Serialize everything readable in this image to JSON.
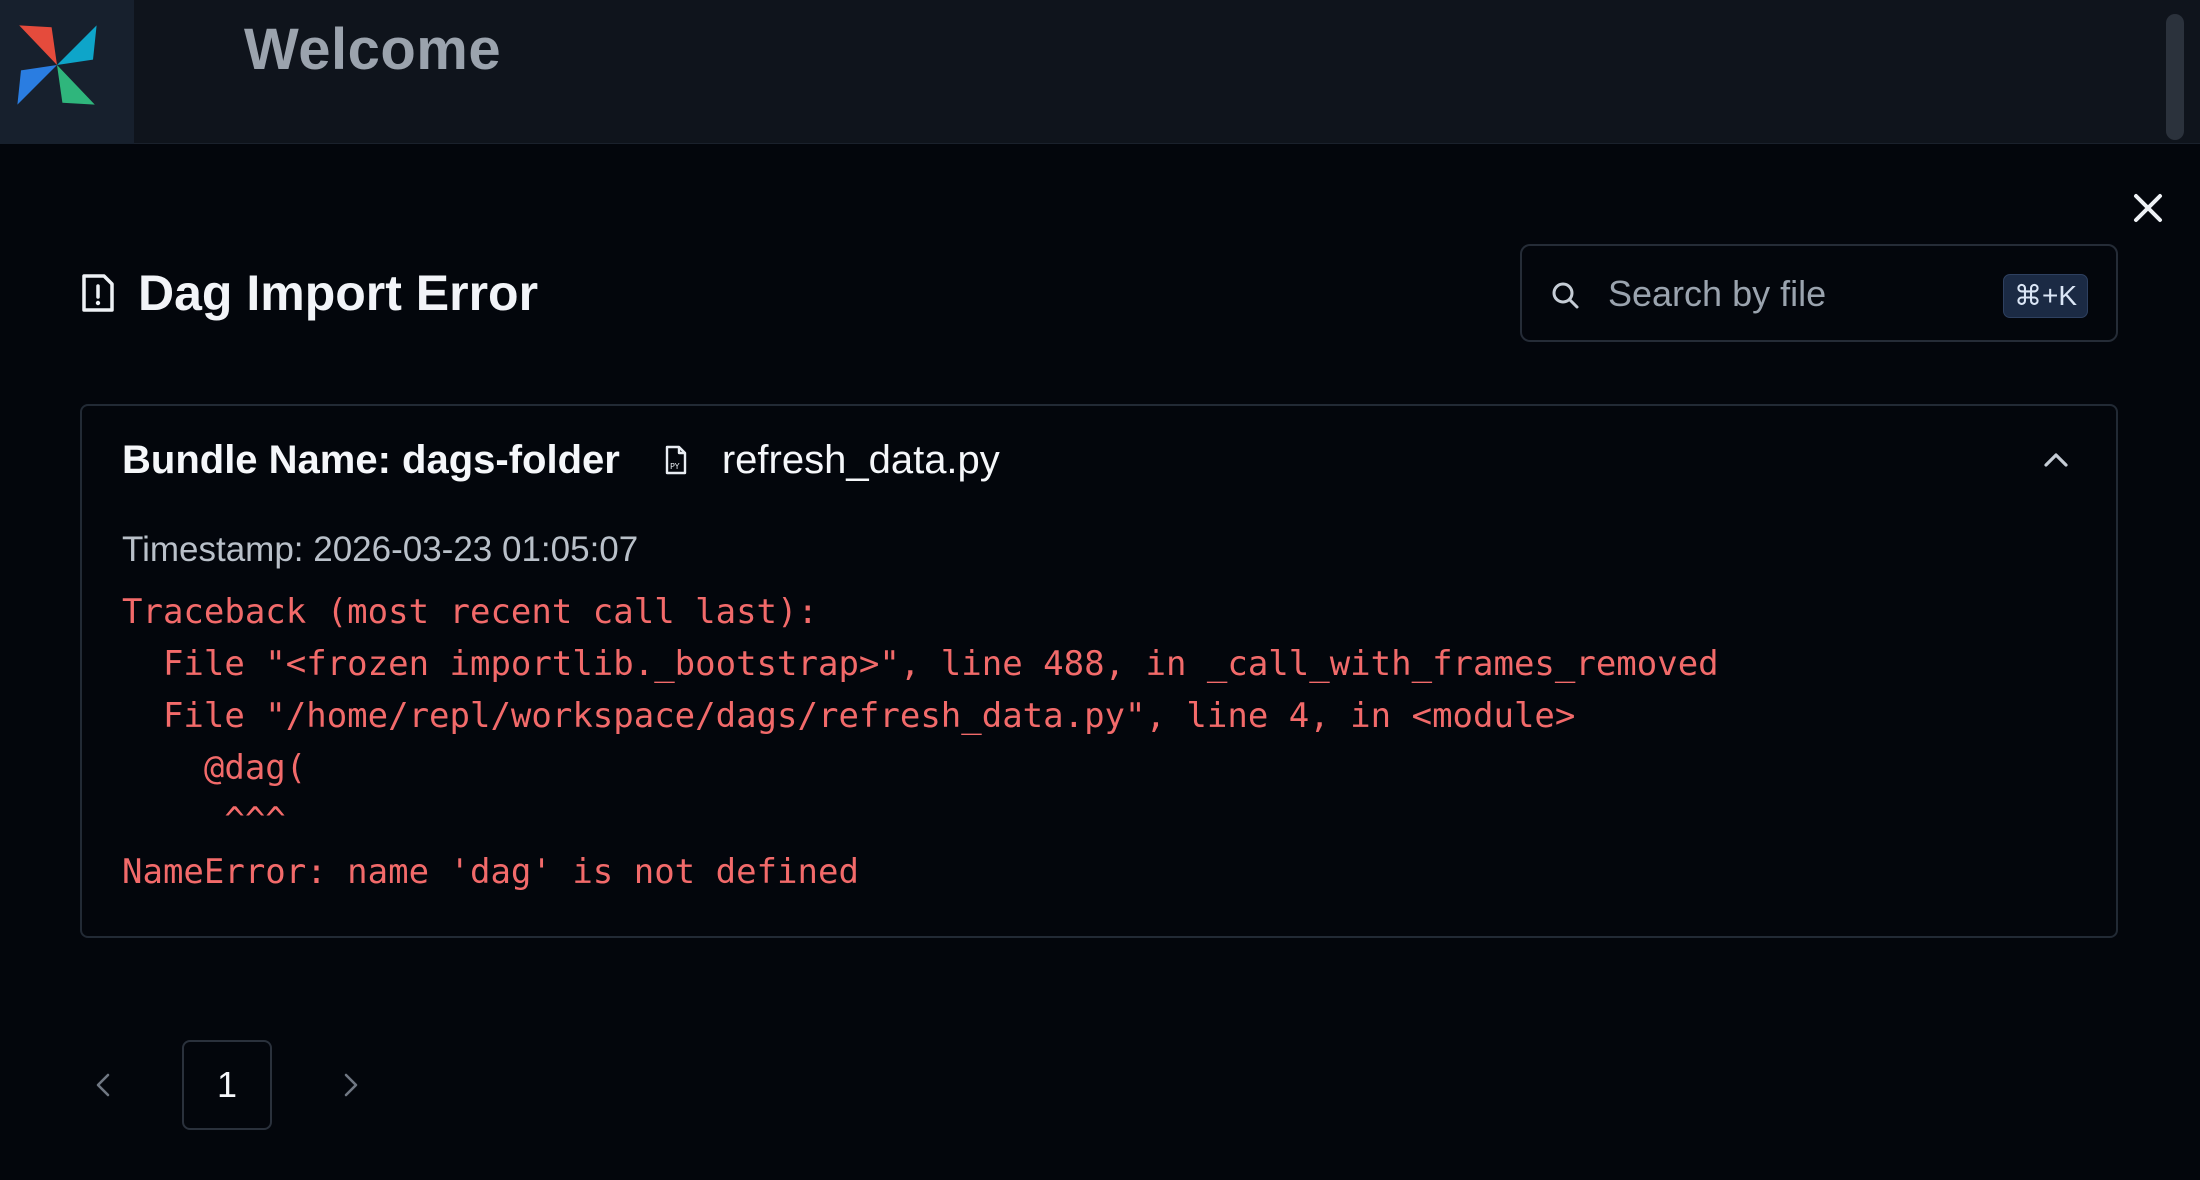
{
  "header": {
    "title": "Welcome",
    "logo_icon": "airflow-pinwheel-icon"
  },
  "modal": {
    "title": "Dag Import Error",
    "title_icon": "file-alert-icon",
    "close_icon": "close-icon",
    "search": {
      "placeholder": "Search by file",
      "value": "",
      "shortcut": "⌘+K",
      "icon": "search-icon"
    },
    "errors": [
      {
        "bundle_label": "Bundle Name: dags-folder",
        "file_icon": "python-file-icon",
        "file_name": "refresh_data.py",
        "timestamp": "Timestamp: 2026-03-23 01:05:07",
        "expanded": true,
        "traceback": "Traceback (most recent call last):\n  File \"<frozen importlib._bootstrap>\", line 488, in _call_with_frames_removed\n  File \"/home/repl/workspace/dags/refresh_data.py\", line 4, in <module>\n    @dag(\n     ^^^\nNameError: name 'dag' is not defined"
      }
    ],
    "pagination": {
      "current_page": "1",
      "prev_icon": "chevron-left-icon",
      "next_icon": "chevron-right-icon"
    }
  },
  "colors": {
    "background": "#03060c",
    "header_background": "#0f141c",
    "error_text": "#f26a6a",
    "border": "#222a35",
    "shortcut_badge": "#1b2a44"
  }
}
